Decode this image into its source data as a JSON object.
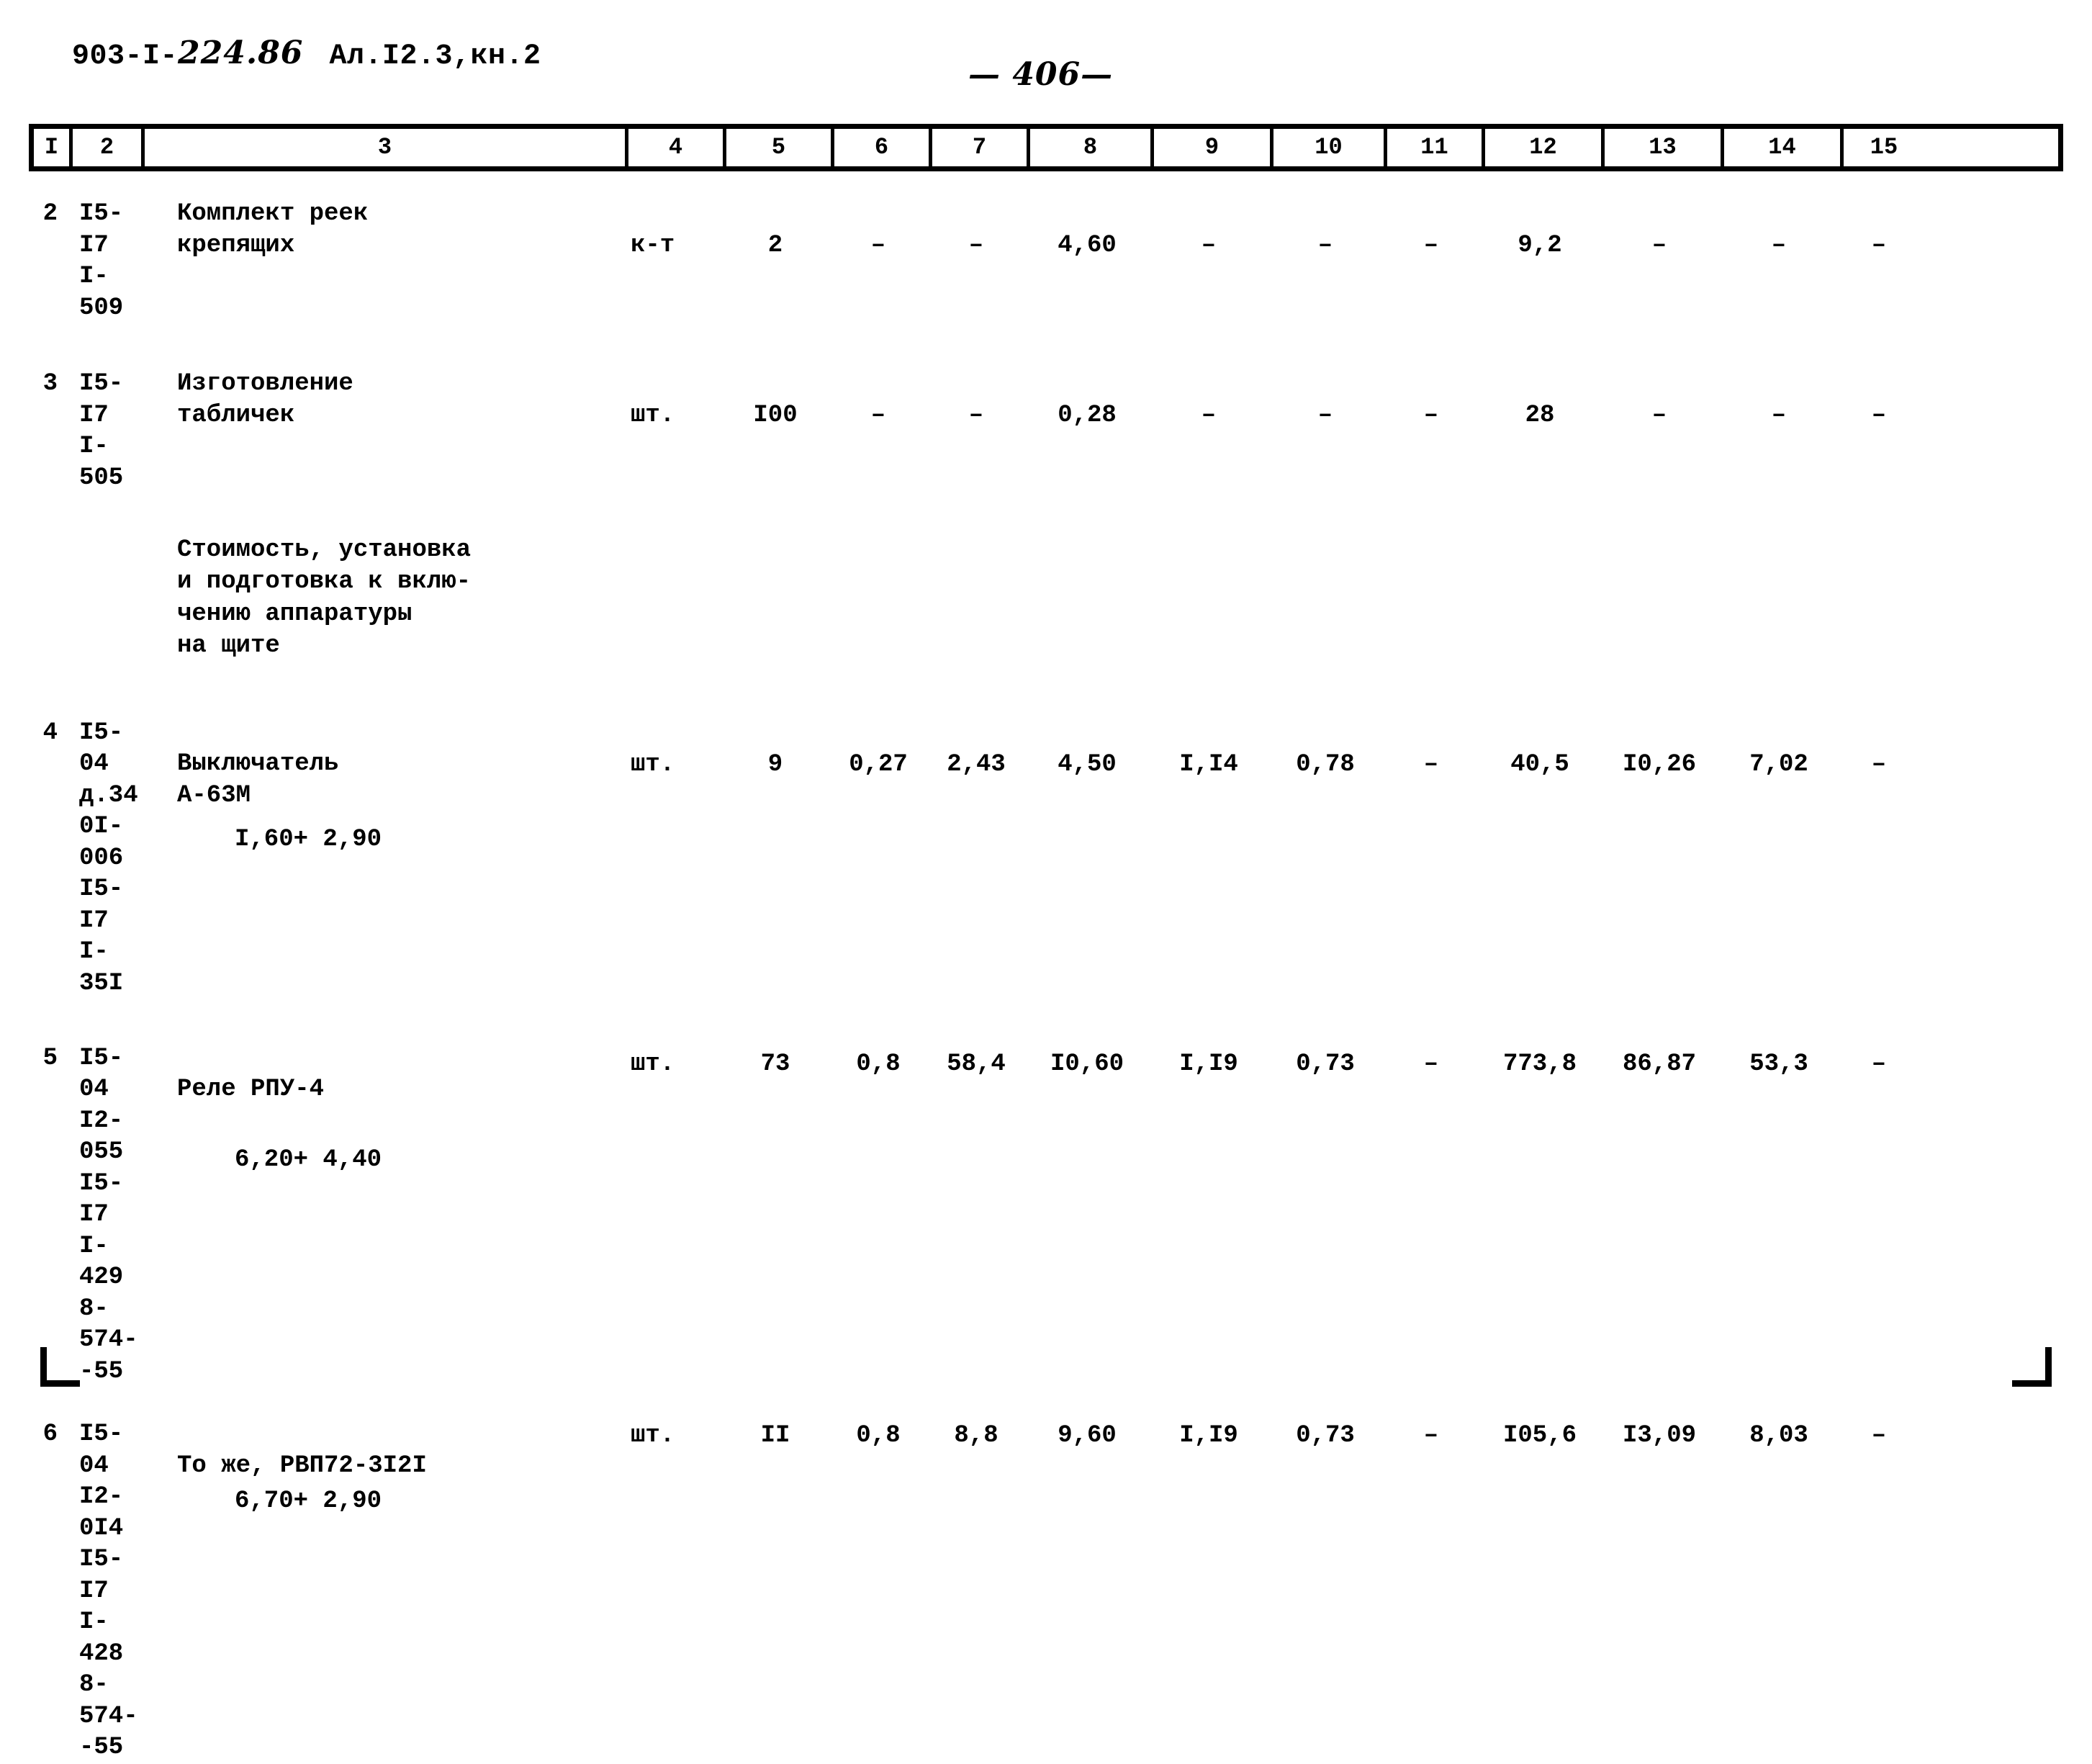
{
  "header": {
    "doc_code_prefix": "903-I-",
    "doc_code_hand": "224.86",
    "album": "Ал.I2.3,кн.2"
  },
  "page_number": "— 406—",
  "table": {
    "column_headers": [
      "I",
      "2",
      "3",
      "4",
      "5",
      "6",
      "7",
      "8",
      "9",
      "10",
      "11",
      "12",
      "13",
      "14",
      "15"
    ],
    "rows": [
      {
        "num": "2",
        "code": "I5-I7\nI-509",
        "name": "Комплект реек\nкрепящих",
        "unit": "к-т",
        "c5": "2",
        "c6": "–",
        "c7": "–",
        "c8": "4,60",
        "c9": "–",
        "c10": "–",
        "c11": "–",
        "c12": "9,2",
        "c13": "–",
        "c14": "–",
        "c15": "–"
      },
      {
        "num": "3",
        "code": "I5-I7\nI-505",
        "name": "Изготовление\nтабличек",
        "unit": "шт.",
        "c5": "I00",
        "c6": "–",
        "c7": "–",
        "c8": "0,28",
        "c9": "–",
        "c10": "–",
        "c11": "–",
        "c12": "28",
        "c13": "–",
        "c14": "–",
        "c15": "–"
      },
      {
        "num": "4",
        "code": "I5-04\nд.34\n0I-006\nI5-I7\nI-35I",
        "name": "Выключатель\nА-63М",
        "sub_amount": "I,60+ 2,90",
        "unit": "шт.",
        "c5": "9",
        "c6": "0,27",
        "c7": "2,43",
        "c8": "4,50",
        "c9": "I,I4",
        "c10": "0,78",
        "c11": "–",
        "c12": "40,5",
        "c13": "I0,26",
        "c14": "7,02",
        "c15": "–"
      },
      {
        "num": "5",
        "code": "I5-04\nI2-055\nI5-I7\nI-429\n8-574-\n-55",
        "name": "Реле РПУ-4",
        "sub_amount": "6,20+ 4,40",
        "unit": "шт.",
        "c5": "73",
        "c6": "0,8",
        "c7": "58,4",
        "c8": "I0,60",
        "c9": "I,I9",
        "c10": "0,73",
        "c11": "–",
        "c12": "773,8",
        "c13": "86,87",
        "c14": "53,3",
        "c15": "–"
      },
      {
        "num": "6",
        "code": "I5-04\nI2-0I4\nI5-I7\nI-428\n8-574-\n-55",
        "name": "То же, РВП72-3I2I",
        "sub_amount": "6,70+ 2,90",
        "unit": "шт.",
        "c5": "II",
        "c6": "0,8",
        "c7": "8,8",
        "c8": "9,60",
        "c9": "I,I9",
        "c10": "0,73",
        "c11": "–",
        "c12": "I05,6",
        "c13": "I3,09",
        "c14": "8,03",
        "c15": "–"
      }
    ],
    "section_note": "Стоимость, установка\nи подготовка к вклю-\nчению аппаратуры\nна щите"
  }
}
